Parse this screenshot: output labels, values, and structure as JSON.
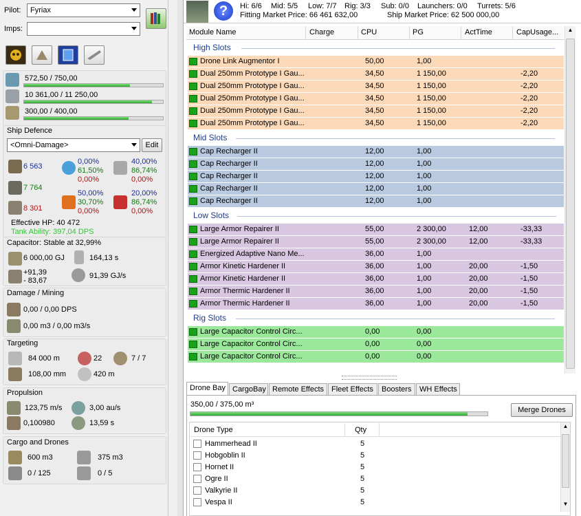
{
  "pilot": {
    "label": "Pilot:",
    "value": "Fyriax"
  },
  "imps": {
    "label": "Imps:",
    "value": ""
  },
  "resources": [
    {
      "text": "572,50 / 750,00",
      "fill": 0.763
    },
    {
      "text": "10 361,00 / 11 250,00",
      "fill": 0.921
    },
    {
      "text": "300,00 / 400,00",
      "fill": 0.75
    }
  ],
  "defence": {
    "title": "Ship Defence",
    "profile": "<Omni-Damage>",
    "edit": "Edit",
    "shield": {
      "hp": "6 563",
      "em": "0,00%",
      "thermal": "61,50%",
      "kinetic": "0,00%",
      "explosive_em": "40,00%",
      "explosive_th": "86,74%",
      "explosive_kin": "0,00%"
    },
    "armor": {
      "hp": "7 764"
    },
    "hull": {
      "hp": "8 301",
      "r1": "50,00%",
      "r2": "30,70%",
      "r3": "0,00%",
      "r4": "20,00%",
      "r5": "86,74%",
      "r6": "0,00%"
    },
    "ehp": "Effective HP: 40 472",
    "tank": "Tank Ability: 397,04 DPS"
  },
  "capacitor": {
    "title": "Capacitor: Stable at 32,99%",
    "capacity": "6 000,00 GJ",
    "time": "164,13 s",
    "delta1": "+91,39",
    "delta2": "- 83,67",
    "rate": "91,39 GJ/s"
  },
  "damage": {
    "title": "Damage / Mining",
    "dps": "0,00 / 0,00 DPS",
    "mining": "0,00 m3 / 0,00 m3/s"
  },
  "targeting": {
    "title": "Targeting",
    "range": "84 000 m",
    "sensor": "22",
    "targets": "7 / 7",
    "res": "108,00 mm",
    "sig": "420 m"
  },
  "propulsion": {
    "title": "Propulsion",
    "speed": "123,75 m/s",
    "warp": "3,00 au/s",
    "agility": "0,100980",
    "align": "13,59 s"
  },
  "cargo": {
    "title": "Cargo and Drones",
    "cargo": "600 m3",
    "drone_bay": "375 m3",
    "bw": "0 / 125",
    "drones": "0 / 5"
  },
  "header": {
    "hi": "Hi: 6/6",
    "mid": "Mid: 5/5",
    "low": "Low: 7/7",
    "rig": "Rig: 3/3",
    "sub": "Sub: 0/0",
    "launchers": "Launchers: 0/0",
    "turrets": "Turrets: 5/6",
    "fitting_price": "Fitting Market Price: 66 461 632,00",
    "ship_price": "Ship Market Price: 62 500 000,00"
  },
  "columns": [
    "Module Name",
    "Charge",
    "CPU",
    "PG",
    "ActTime",
    "CapUsage..."
  ],
  "sections": {
    "high": "High Slots",
    "mid": "Mid Slots",
    "low": "Low Slots",
    "rig": "Rig Slots"
  },
  "colors": {
    "high": "#fcd9b8",
    "mid": "#b8c9e0",
    "low": "#d9c6e0",
    "rig": "#9be89b"
  },
  "high": [
    [
      "Drone Link Augmentor I",
      "",
      "50,00",
      "1,00",
      "",
      ""
    ],
    [
      "Dual 250mm Prototype I Gau...",
      "",
      "34,50",
      "1 150,00",
      "",
      "-2,20"
    ],
    [
      "Dual 250mm Prototype I Gau...",
      "",
      "34,50",
      "1 150,00",
      "",
      "-2,20"
    ],
    [
      "Dual 250mm Prototype I Gau...",
      "",
      "34,50",
      "1 150,00",
      "",
      "-2,20"
    ],
    [
      "Dual 250mm Prototype I Gau...",
      "",
      "34,50",
      "1 150,00",
      "",
      "-2,20"
    ],
    [
      "Dual 250mm Prototype I Gau...",
      "",
      "34,50",
      "1 150,00",
      "",
      "-2,20"
    ]
  ],
  "mid": [
    [
      "Cap Recharger II",
      "",
      "12,00",
      "1,00",
      "",
      ""
    ],
    [
      "Cap Recharger II",
      "",
      "12,00",
      "1,00",
      "",
      ""
    ],
    [
      "Cap Recharger II",
      "",
      "12,00",
      "1,00",
      "",
      ""
    ],
    [
      "Cap Recharger II",
      "",
      "12,00",
      "1,00",
      "",
      ""
    ],
    [
      "Cap Recharger II",
      "",
      "12,00",
      "1,00",
      "",
      ""
    ]
  ],
  "low": [
    [
      "Large Armor Repairer II",
      "",
      "55,00",
      "2 300,00",
      "12,00",
      "-33,33"
    ],
    [
      "Large Armor Repairer II",
      "",
      "55,00",
      "2 300,00",
      "12,00",
      "-33,33"
    ],
    [
      "Energized Adaptive Nano Me...",
      "",
      "36,00",
      "1,00",
      "",
      ""
    ],
    [
      "Armor Kinetic Hardener II",
      "",
      "36,00",
      "1,00",
      "20,00",
      "-1,50"
    ],
    [
      "Armor Kinetic Hardener II",
      "",
      "36,00",
      "1,00",
      "20,00",
      "-1,50"
    ],
    [
      "Armor Thermic Hardener II",
      "",
      "36,00",
      "1,00",
      "20,00",
      "-1,50"
    ],
    [
      "Armor Thermic Hardener II",
      "",
      "36,00",
      "1,00",
      "20,00",
      "-1,50"
    ]
  ],
  "rig": [
    [
      "Large Capacitor Control Circ...",
      "",
      "0,00",
      "0,00",
      "",
      ""
    ],
    [
      "Large Capacitor Control Circ...",
      "",
      "0,00",
      "0,00",
      "",
      ""
    ],
    [
      "Large Capacitor Control Circ...",
      "",
      "0,00",
      "0,00",
      "",
      ""
    ]
  ],
  "tabs": [
    "Drone Bay",
    "CargoBay",
    "Remote Effects",
    "Fleet Effects",
    "Boosters",
    "WH Effects"
  ],
  "drone_bay": {
    "usage": "350,00 / 375,00 m³",
    "fill": 0.933,
    "merge": "Merge Drones",
    "col_type": "Drone Type",
    "col_qty": "Qty",
    "drones": [
      [
        "Hammerhead II",
        "5"
      ],
      [
        "Hobgoblin II",
        "5"
      ],
      [
        "Hornet II",
        "5"
      ],
      [
        "Ogre II",
        "5"
      ],
      [
        "Valkyrie II",
        "5"
      ],
      [
        "Vespa II",
        "5"
      ]
    ]
  }
}
